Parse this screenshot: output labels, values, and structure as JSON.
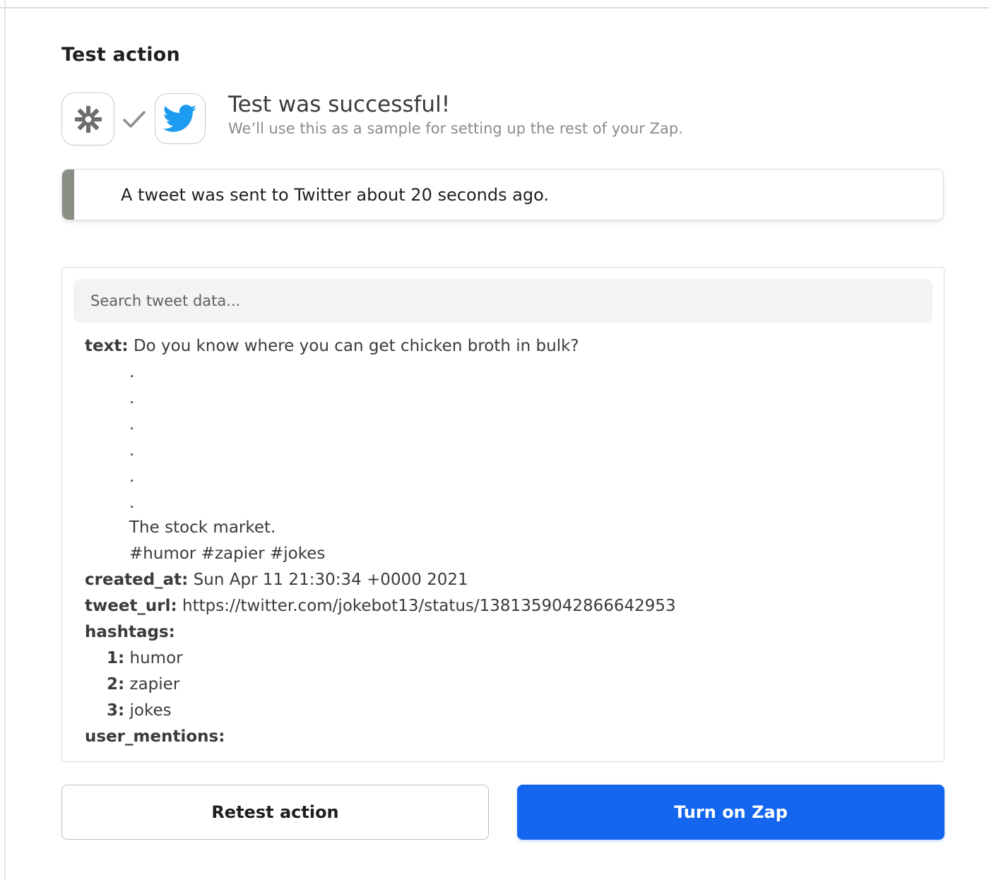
{
  "section": {
    "title": "Test action"
  },
  "icons": {
    "trigger": "zapier-asterisk-icon",
    "status": "check-icon",
    "action": "twitter-bird-icon"
  },
  "status": {
    "title": "Test was successful!",
    "subtitle": "We’ll use this as a sample for setting up the rest of your Zap."
  },
  "banner": {
    "text": "A tweet was sent to Twitter about 20 seconds ago."
  },
  "search": {
    "placeholder": "Search tweet data..."
  },
  "tweet": {
    "text_label": "text:",
    "text_lines": [
      "Do you know where you can get chicken broth in bulk?",
      ".",
      ".",
      ".",
      ".",
      ".",
      ".",
      "The stock market.",
      "#humor #zapier #jokes"
    ],
    "created_at_label": "created_at:",
    "created_at": "Sun Apr 11 21:30:34 +0000 2021",
    "tweet_url_label": "tweet_url:",
    "tweet_url": "https://twitter.com/jokebot13/status/1381359042866642953",
    "hashtags_label": "hashtags:",
    "hashtags": [
      {
        "index": "1:",
        "value": "humor"
      },
      {
        "index": "2:",
        "value": "zapier"
      },
      {
        "index": "3:",
        "value": "jokes"
      }
    ],
    "user_mentions_label": "user_mentions:"
  },
  "buttons": {
    "retest": "Retest action",
    "turn_on": "Turn on Zap"
  },
  "colors": {
    "primary": "#1466ef",
    "banner_bar": "#8a8f86",
    "twitter": "#1d9bf0",
    "zapier_icon": "#6b6e6a"
  }
}
